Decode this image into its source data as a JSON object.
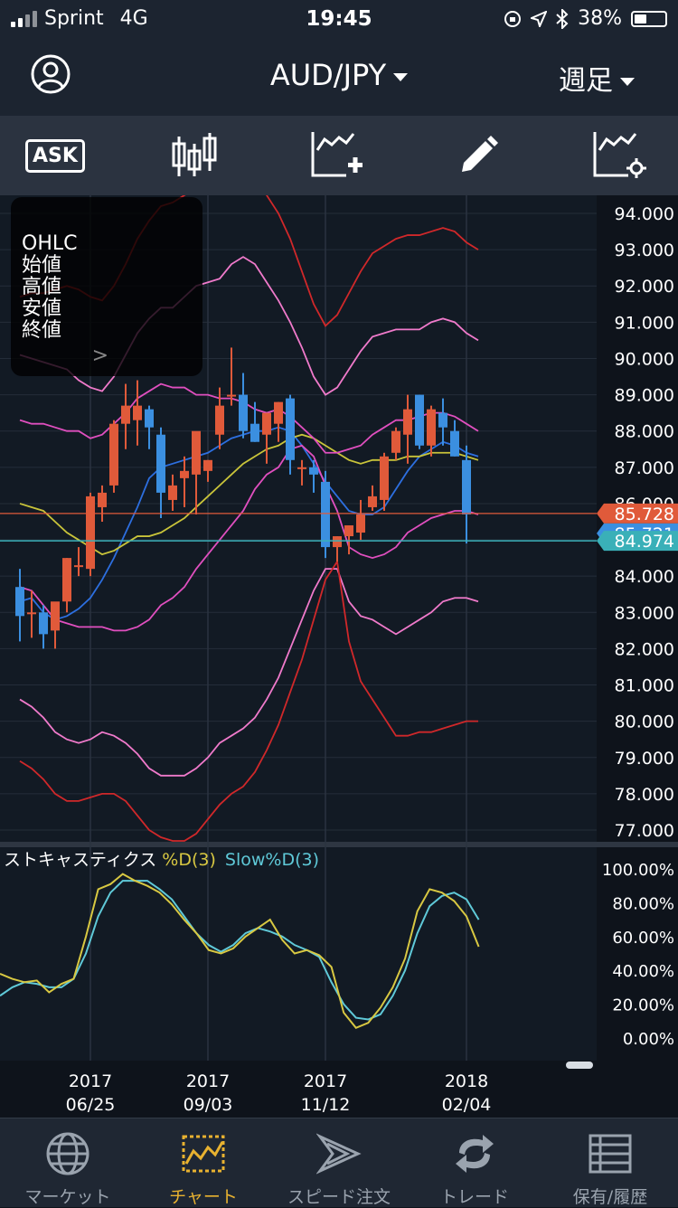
{
  "status_bar": {
    "carrier": "Sprint",
    "network": "4G",
    "time": "19:45",
    "battery": "38%",
    "battery_level": 0.38
  },
  "header": {
    "symbol": "AUD/JPY",
    "period": "週足"
  },
  "toolbar": {
    "ask_label": "ASK"
  },
  "ohlc_panel": {
    "title": "OHLC",
    "open": "始値",
    "high": "高値",
    "low": "安値",
    "close": "終値"
  },
  "price_axis": {
    "ticks": [
      "94.000",
      "93.000",
      "92.000",
      "91.000",
      "90.000",
      "89.000",
      "88.000",
      "87.000",
      "86.000",
      "85.000",
      "84.000",
      "83.000",
      "82.000",
      "81.000",
      "80.000",
      "79.000",
      "78.000",
      "77.000"
    ]
  },
  "price_labels": {
    "ask": "85.728",
    "bid": "85.721",
    "line": "84.974"
  },
  "stoch_axis": {
    "ticks": [
      "100.00%",
      "80.00%",
      "60.00%",
      "40.00%",
      "20.00%",
      "0.00%"
    ]
  },
  "indicator": {
    "name": "ストキャスティクス",
    "d_label": "%D(3)",
    "slowd_label": "Slow%D(3)"
  },
  "time_axis": [
    {
      "year": "2017",
      "date": "06/25"
    },
    {
      "year": "2017",
      "date": "09/03"
    },
    {
      "year": "2017",
      "date": "11/12"
    },
    {
      "year": "2018",
      "date": "02/04"
    }
  ],
  "colors": {
    "up": "#e05a3a",
    "down": "#3b8fe0",
    "ma": "#2d6fe0",
    "ma_long": "#c9c43a",
    "bb1": "#e04fbf",
    "bb2": "#f07acb",
    "bb3": "#d0282a",
    "stoch_d": "#d8c842",
    "stoch_slow": "#5fc9d8",
    "ask_label": "#e05a3a",
    "bid_label": "#3b8fe0",
    "line_label": "#3ab0b8",
    "accent": "#e8b230"
  },
  "chart_data": {
    "type": "candlestick",
    "ylim": [
      77,
      94
    ],
    "candles": [
      {
        "o": 83.7,
        "h": 84.2,
        "l": 82.2,
        "c": 82.9
      },
      {
        "o": 83.0,
        "h": 83.6,
        "l": 82.3,
        "c": 83.0
      },
      {
        "o": 83.0,
        "h": 83.2,
        "l": 82.0,
        "c": 82.4
      },
      {
        "o": 82.5,
        "h": 83.2,
        "l": 82.0,
        "c": 83.3
      },
      {
        "o": 83.3,
        "h": 84.5,
        "l": 83.0,
        "c": 84.5
      },
      {
        "o": 84.3,
        "h": 84.8,
        "l": 84.0,
        "c": 84.3
      },
      {
        "o": 84.2,
        "h": 86.3,
        "l": 84.0,
        "c": 86.2
      },
      {
        "o": 85.9,
        "h": 86.5,
        "l": 85.5,
        "c": 86.3
      },
      {
        "o": 86.5,
        "h": 88.3,
        "l": 86.3,
        "c": 88.2
      },
      {
        "o": 88.2,
        "h": 89.3,
        "l": 87.5,
        "c": 88.7
      },
      {
        "o": 88.3,
        "h": 89.4,
        "l": 87.6,
        "c": 88.7
      },
      {
        "o": 88.6,
        "h": 88.7,
        "l": 87.5,
        "c": 88.1
      },
      {
        "o": 87.9,
        "h": 88.1,
        "l": 85.6,
        "c": 86.3
      },
      {
        "o": 86.1,
        "h": 86.8,
        "l": 85.8,
        "c": 86.5
      },
      {
        "o": 86.7,
        "h": 87.3,
        "l": 85.9,
        "c": 86.9
      },
      {
        "o": 86.8,
        "h": 87.9,
        "l": 85.7,
        "c": 88.0
      },
      {
        "o": 86.9,
        "h": 87.2,
        "l": 86.6,
        "c": 87.2
      },
      {
        "o": 87.9,
        "h": 89.2,
        "l": 87.5,
        "c": 88.7
      },
      {
        "o": 89.0,
        "h": 90.3,
        "l": 88.7,
        "c": 89.0
      },
      {
        "o": 89.0,
        "h": 89.6,
        "l": 87.8,
        "c": 88.0
      },
      {
        "o": 88.2,
        "h": 88.8,
        "l": 87.7,
        "c": 87.7
      },
      {
        "o": 87.9,
        "h": 88.5,
        "l": 87.1,
        "c": 88.5
      },
      {
        "o": 88.2,
        "h": 88.8,
        "l": 87.7,
        "c": 88.8
      },
      {
        "o": 88.9,
        "h": 89.0,
        "l": 86.8,
        "c": 87.2
      },
      {
        "o": 87.0,
        "h": 87.2,
        "l": 86.5,
        "c": 87.0
      },
      {
        "o": 87.0,
        "h": 87.2,
        "l": 86.3,
        "c": 86.8
      },
      {
        "o": 86.6,
        "h": 86.9,
        "l": 84.5,
        "c": 84.8
      },
      {
        "o": 84.8,
        "h": 85.1,
        "l": 84.4,
        "c": 85.1
      },
      {
        "o": 85.1,
        "h": 85.4,
        "l": 84.6,
        "c": 85.4
      },
      {
        "o": 85.2,
        "h": 86.1,
        "l": 85.0,
        "c": 85.7
      },
      {
        "o": 85.9,
        "h": 86.5,
        "l": 85.8,
        "c": 86.2
      },
      {
        "o": 86.1,
        "h": 87.4,
        "l": 85.8,
        "c": 87.3
      },
      {
        "o": 87.4,
        "h": 88.1,
        "l": 87.2,
        "c": 88.0
      },
      {
        "o": 87.9,
        "h": 89.0,
        "l": 87.1,
        "c": 88.6
      },
      {
        "o": 89.0,
        "h": 89.0,
        "l": 87.5,
        "c": 87.6
      },
      {
        "o": 87.6,
        "h": 88.7,
        "l": 87.3,
        "c": 88.6
      },
      {
        "o": 88.5,
        "h": 88.9,
        "l": 87.6,
        "c": 88.1
      },
      {
        "o": 88.0,
        "h": 88.3,
        "l": 87.3,
        "c": 87.3
      },
      {
        "o": 87.2,
        "h": 87.6,
        "l": 84.9,
        "c": 85.7
      }
    ],
    "series": [
      {
        "values": [
          83.3,
          83.4,
          83.0,
          82.8,
          82.9,
          83.1,
          83.4,
          83.9,
          84.5,
          85.2,
          85.9,
          86.7,
          87.0,
          87.1,
          87.2,
          87.3,
          87.4,
          87.6,
          87.8,
          87.9,
          88.0,
          88.0,
          88.1,
          88.0,
          87.6,
          87.1,
          86.6,
          86.2,
          85.8,
          85.7,
          85.7,
          85.9,
          86.4,
          86.9,
          87.3,
          87.5,
          87.7,
          87.6,
          87.4,
          87.3
        ]
      },
      {
        "values": [
          86.0,
          85.9,
          85.8,
          85.5,
          85.2,
          85.0,
          84.8,
          84.6,
          84.7,
          84.9,
          85.1,
          85.1,
          85.2,
          85.4,
          85.6,
          85.9,
          86.2,
          86.5,
          86.8,
          87.1,
          87.3,
          87.5,
          87.6,
          87.8,
          87.9,
          87.8,
          87.6,
          87.4,
          87.2,
          87.1,
          87.2,
          87.2,
          87.2,
          87.3,
          87.3,
          87.4,
          87.4,
          87.4,
          87.3,
          87.2
        ]
      },
      {
        "values": [
          88.3,
          88.2,
          88.2,
          88.1,
          88.0,
          88.0,
          87.8,
          87.9,
          88.2,
          88.5,
          88.9,
          89.1,
          89.3,
          89.2,
          89.2,
          89.0,
          89.0,
          88.9,
          88.9,
          88.8,
          88.6,
          88.5,
          88.6,
          88.4,
          88.1,
          87.8,
          87.4,
          87.4,
          87.5,
          87.6,
          87.9,
          88.1,
          88.3,
          88.3,
          88.4,
          88.5,
          88.5,
          88.4,
          88.2,
          88.0
        ]
      },
      {
        "values": [
          83.7,
          83.6,
          83.2,
          82.8,
          82.7,
          82.6,
          82.6,
          82.6,
          82.5,
          82.5,
          82.6,
          82.8,
          83.2,
          83.4,
          83.7,
          84.2,
          84.6,
          85.0,
          85.4,
          85.8,
          86.4,
          86.8,
          87.0,
          87.5,
          87.6,
          87.3,
          86.5,
          85.8,
          84.8,
          84.6,
          84.5,
          84.6,
          84.8,
          85.2,
          85.4,
          85.6,
          85.7,
          85.8,
          85.8,
          85.7
        ]
      },
      {
        "values": [
          90.1,
          90.0,
          89.9,
          89.8,
          89.7,
          89.4,
          89.2,
          89.1,
          89.5,
          90.1,
          90.7,
          91.1,
          91.4,
          91.4,
          91.7,
          92.0,
          92.1,
          92.2,
          92.6,
          92.8,
          92.6,
          92.1,
          91.6,
          91.0,
          90.3,
          89.5,
          89.0,
          89.2,
          89.7,
          90.2,
          90.6,
          90.7,
          90.8,
          90.8,
          90.8,
          91.0,
          91.1,
          91.0,
          90.7,
          90.5
        ]
      },
      {
        "values": [
          80.6,
          80.4,
          80.1,
          79.7,
          79.5,
          79.4,
          79.5,
          79.7,
          79.6,
          79.4,
          79.1,
          78.7,
          78.5,
          78.5,
          78.5,
          78.7,
          79.0,
          79.4,
          79.6,
          79.8,
          80.1,
          80.6,
          81.2,
          82.0,
          82.8,
          83.6,
          84.2,
          84.2,
          83.3,
          82.9,
          82.8,
          82.6,
          82.4,
          82.6,
          82.8,
          83.0,
          83.3,
          83.4,
          83.4,
          83.3
        ]
      },
      {
        "values": [
          91.7,
          91.8,
          91.8,
          91.9,
          92.0,
          91.9,
          91.7,
          91.6,
          92.0,
          92.6,
          93.3,
          93.8,
          94.2,
          94.3,
          94.5,
          94.7,
          94.8,
          94.9,
          95.1,
          95.2,
          95.0,
          94.5,
          94.0,
          93.3,
          92.4,
          91.5,
          90.9,
          91.2,
          91.8,
          92.4,
          92.9,
          93.1,
          93.3,
          93.4,
          93.4,
          93.5,
          93.6,
          93.5,
          93.2,
          93.0
        ]
      },
      {
        "values": [
          78.9,
          78.7,
          78.4,
          78.0,
          77.8,
          77.8,
          77.9,
          78.0,
          78.0,
          77.8,
          77.4,
          77.0,
          76.8,
          76.7,
          76.7,
          76.9,
          77.3,
          77.7,
          78.0,
          78.2,
          78.6,
          79.2,
          79.9,
          80.8,
          81.7,
          82.8,
          83.9,
          84.4,
          82.2,
          81.1,
          80.6,
          80.1,
          79.6,
          79.6,
          79.7,
          79.7,
          79.8,
          79.9,
          80.0,
          80.0
        ]
      }
    ],
    "stoch_d": [
      38,
      35,
      33,
      34,
      27,
      32,
      35,
      60,
      88,
      91,
      97,
      93,
      90,
      86,
      79,
      70,
      62,
      52,
      50,
      53,
      60,
      65,
      70,
      58,
      50,
      52,
      49,
      42,
      15,
      6,
      9,
      18,
      30,
      47,
      75,
      88,
      86,
      81,
      72,
      54
    ],
    "stoch_slow": [
      25,
      30,
      33,
      32,
      30,
      30,
      35,
      50,
      72,
      86,
      93,
      93,
      93,
      88,
      82,
      72,
      62,
      55,
      51,
      55,
      62,
      65,
      63,
      60,
      55,
      52,
      48,
      33,
      20,
      12,
      11,
      14,
      25,
      40,
      62,
      78,
      84,
      86,
      82,
      70
    ]
  }
}
